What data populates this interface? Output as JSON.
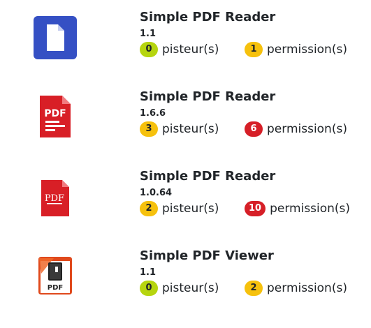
{
  "apps": [
    {
      "name": "Simple PDF Reader",
      "version": "1.1",
      "icon": "document-icon",
      "trackers": {
        "count": "0",
        "label": "pisteur(s)",
        "level": "green"
      },
      "permissions": {
        "count": "1",
        "label": "permission(s)",
        "level": "yellow"
      }
    },
    {
      "name": "Simple PDF Reader",
      "version": "1.6.6",
      "icon": "pdf-icon",
      "icon_text": "PDF",
      "trackers": {
        "count": "3",
        "label": "pisteur(s)",
        "level": "yellow"
      },
      "permissions": {
        "count": "6",
        "label": "permission(s)",
        "level": "red"
      }
    },
    {
      "name": "Simple PDF Reader",
      "version": "1.0.64",
      "icon": "pdf-icon",
      "icon_text": "PDF",
      "trackers": {
        "count": "2",
        "label": "pisteur(s)",
        "level": "yellow"
      },
      "permissions": {
        "count": "10",
        "label": "permission(s)",
        "level": "red"
      }
    },
    {
      "name": "Simple PDF Viewer",
      "version": "1.1",
      "icon": "pdf-book-icon",
      "icon_text": "PDF",
      "trackers": {
        "count": "0",
        "label": "pisteur(s)",
        "level": "green"
      },
      "permissions": {
        "count": "2",
        "label": "permission(s)",
        "level": "yellow"
      }
    }
  ],
  "colors": {
    "green": "#b6d50f",
    "yellow": "#f6c10d",
    "red": "#d61f27",
    "blue_icon": "#3550c4",
    "pdf_red": "#d81f26"
  }
}
